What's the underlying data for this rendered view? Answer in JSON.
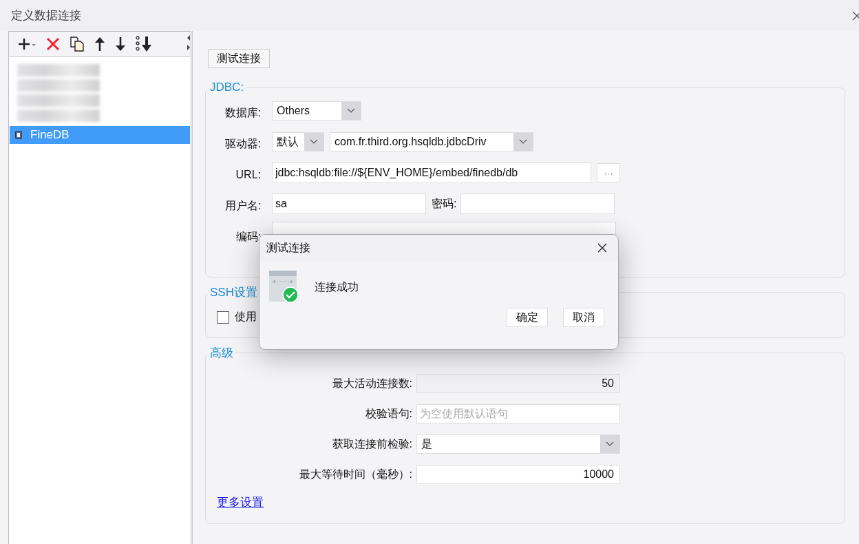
{
  "window": {
    "title": "定义数据连接"
  },
  "connections": [
    {
      "kind": "redacted",
      "selected": false
    },
    {
      "kind": "redacted",
      "selected": false
    },
    {
      "kind": "redacted",
      "selected": false
    },
    {
      "kind": "redacted",
      "selected": false
    },
    {
      "kind": "item",
      "name": "FineDB",
      "selected": true
    }
  ],
  "test_button": "测试连接",
  "jdbc": {
    "legend": "JDBC:",
    "database_label": "数据库:",
    "database": "Others",
    "driver_label": "驱动器:",
    "driver_mode": "默认",
    "driver": "com.fr.third.org.hsqldb.jdbcDriv",
    "url_label": "URL:",
    "url": "jdbc:hsqldb:file://${ENV_HOME}/embed/finedb/db",
    "more_glyph": "···",
    "user_label": "用户名:",
    "user": "sa",
    "password_label": "密码:",
    "encoding_label": "编码:"
  },
  "ssh": {
    "legend": "SSH设置",
    "checkbox_label": "使用",
    "checked": false
  },
  "advanced": {
    "legend": "高级",
    "rows": [
      {
        "kind": "number",
        "label": "最大活动连接数:",
        "value": "50"
      },
      {
        "kind": "text",
        "label": "校验语句:",
        "placeholder": "为空使用默认语句"
      },
      {
        "kind": "select",
        "label": "获取连接前检验:",
        "value": "是"
      },
      {
        "kind": "number",
        "label": "最大等待时间（毫秒）:",
        "value": "10000"
      }
    ],
    "more_link": "更多设置"
  },
  "dialog": {
    "title": "测试连接",
    "message": "连接成功",
    "buttons": [
      "确定",
      "取消"
    ]
  }
}
